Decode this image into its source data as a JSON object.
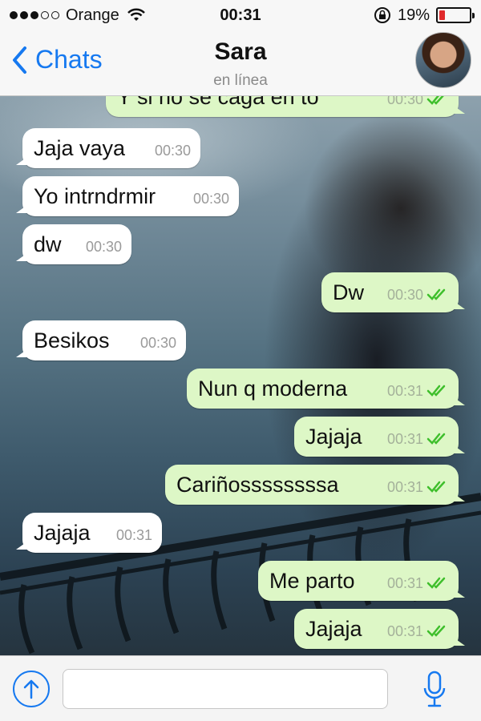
{
  "status_bar": {
    "carrier": "Orange",
    "time": "00:31",
    "battery_pct": "19%",
    "battery_level": 0.19,
    "signal_bars": 3,
    "signal_total": 5
  },
  "nav": {
    "back_label": "Chats",
    "contact_name": "Sara",
    "contact_status": "en línea"
  },
  "colors": {
    "accent": "#1679f0",
    "outgoing_bubble": "#ddf7c6",
    "incoming_bubble": "#ffffff",
    "read_ticks": "#3fbf2c"
  },
  "messages": [
    {
      "dir": "out",
      "text": "Y si no se caga en to",
      "time": "00:30",
      "read": true
    },
    {
      "dir": "in",
      "text": "Jaja vaya",
      "time": "00:30"
    },
    {
      "dir": "in",
      "text": "Yo intrndrmir",
      "time": "00:30"
    },
    {
      "dir": "in",
      "text": "dw",
      "time": "00:30"
    },
    {
      "dir": "out",
      "text": "Dw",
      "time": "00:30",
      "read": true
    },
    {
      "dir": "in",
      "text": "Besikos",
      "time": "00:30"
    },
    {
      "dir": "out",
      "text": "Nun q moderna",
      "time": "00:31",
      "read": true
    },
    {
      "dir": "out",
      "text": "Jajaja",
      "time": "00:31",
      "read": true
    },
    {
      "dir": "out",
      "text": "Cariñossssssssa",
      "time": "00:31",
      "read": true
    },
    {
      "dir": "in",
      "text": "Jajaja",
      "time": "00:31"
    },
    {
      "dir": "out",
      "text": "Me parto",
      "time": "00:31",
      "read": true
    },
    {
      "dir": "out",
      "text": "Jajaja",
      "time": "00:31",
      "read": true
    }
  ],
  "composer": {
    "message_value": "",
    "share_icon": "upload-arrow-icon",
    "mic_icon": "microphone-icon"
  }
}
